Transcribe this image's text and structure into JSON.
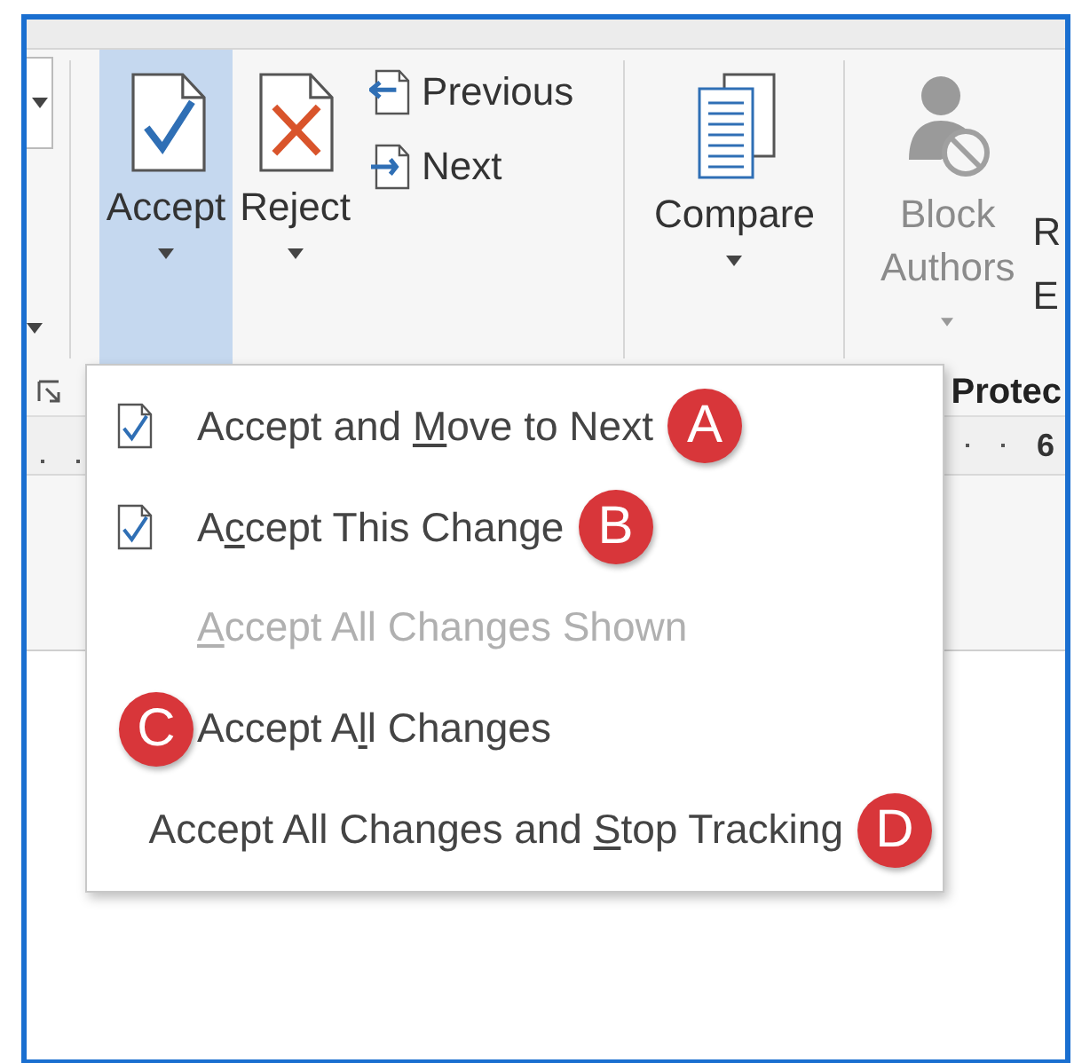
{
  "ribbon": {
    "commands": [
      {
        "kind": "accept",
        "label": "Accept",
        "selected": true
      },
      {
        "kind": "reject",
        "label": "Reject",
        "selected": false
      },
      {
        "kind": "nav",
        "items": [
          {
            "kind": "previous",
            "label": "Previous"
          },
          {
            "kind": "next",
            "label": "Next"
          }
        ]
      },
      {
        "kind": "separator"
      },
      {
        "kind": "compare",
        "label": "Compare",
        "selected": false
      },
      {
        "kind": "separator"
      },
      {
        "kind": "block",
        "lines": [
          "Block",
          "Authors"
        ],
        "disabled": true
      },
      {
        "kind": "cut",
        "lines": [
          "R",
          "E"
        ]
      }
    ],
    "group_label": "Protec",
    "ruler_mark": "6"
  },
  "menu": {
    "items": [
      {
        "kind": "check",
        "before": "Accept and ",
        "key": "M",
        "after": "ove to Next",
        "disabled": false,
        "badge": {
          "kind": "trailing",
          "letter": "A"
        }
      },
      {
        "kind": "check",
        "before": "A",
        "key": "c",
        "after": "cept This Change",
        "disabled": false,
        "badge": {
          "kind": "trailing",
          "letter": "B"
        }
      },
      {
        "kind": "plain",
        "key": "A",
        "after": "ccept All Changes Shown",
        "disabled": true
      },
      {
        "kind": "plain",
        "before": "Accept A",
        "key": "l",
        "after": "l Changes",
        "disabled": false,
        "badge": {
          "kind": "leading",
          "letter": "C"
        }
      },
      {
        "kind": "plain",
        "before": "Accept All Changes and ",
        "key": "S",
        "after": "top Tracking",
        "disabled": false,
        "badge": {
          "kind": "trailing",
          "letter": "D"
        }
      }
    ]
  }
}
